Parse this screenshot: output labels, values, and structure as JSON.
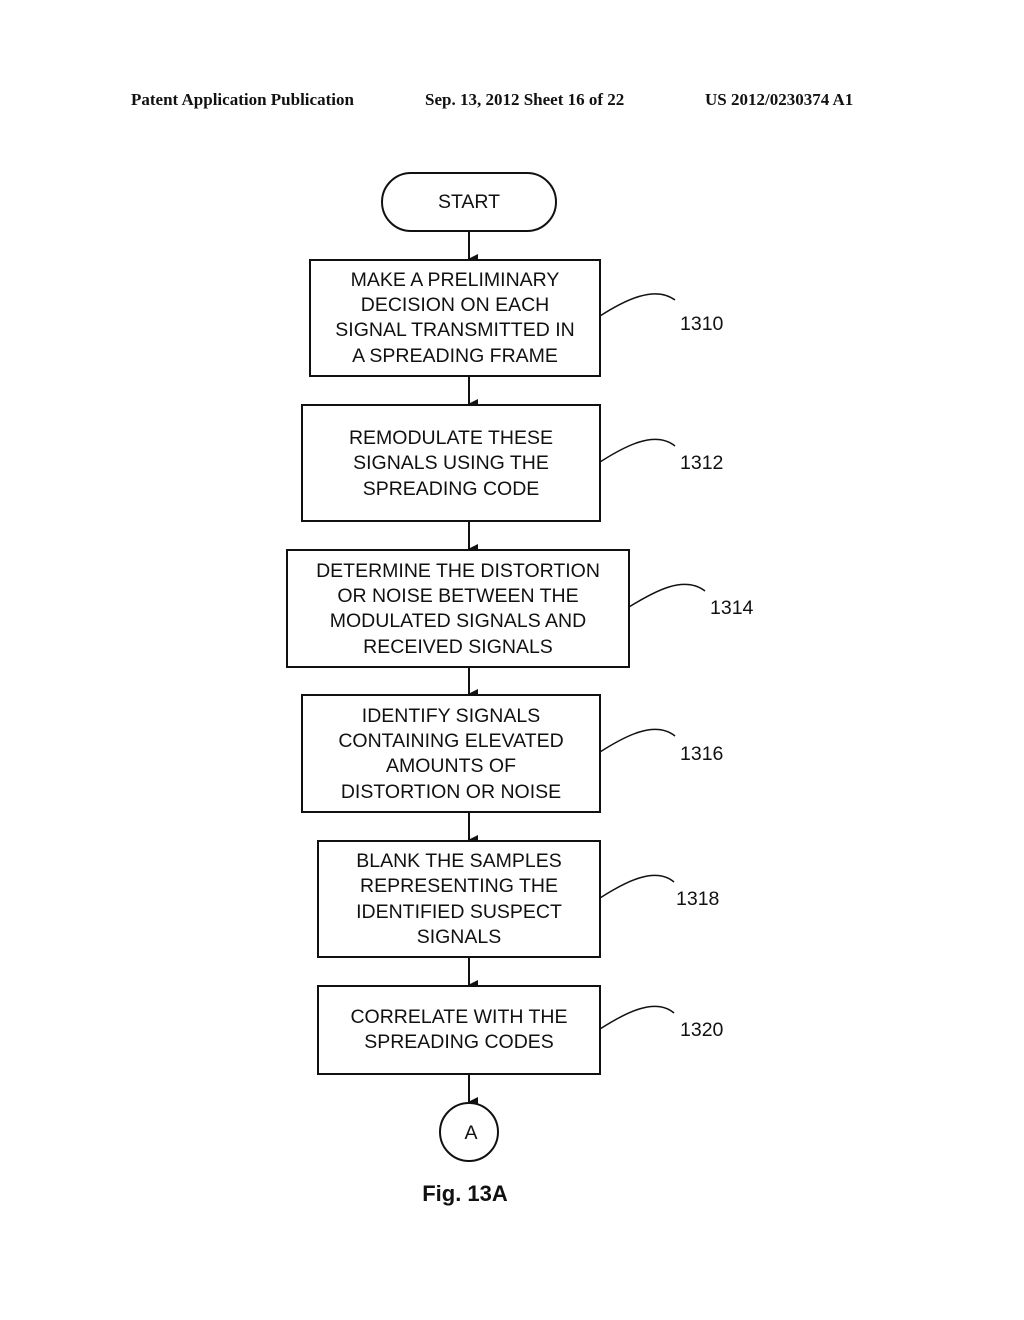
{
  "header": {
    "left": "Patent Application Publication",
    "date_sheet": "Sep. 13, 2012   Sheet 16 of 22",
    "number": "US 2012/0230374 A1"
  },
  "flowchart": {
    "start_label": "START",
    "steps": [
      {
        "ref": "1310",
        "lines": [
          "MAKE A PRELIMINARY",
          "DECISION ON EACH",
          "SIGNAL TRANSMITTED IN",
          "A SPREADING FRAME"
        ]
      },
      {
        "ref": "1312",
        "lines": [
          "REMODULATE THESE",
          "SIGNALS USING THE",
          "SPREADING CODE"
        ]
      },
      {
        "ref": "1314",
        "lines": [
          "DETERMINE THE DISTORTION",
          "OR NOISE BETWEEN THE",
          "MODULATED SIGNALS AND",
          "RECEIVED SIGNALS"
        ]
      },
      {
        "ref": "1316",
        "lines": [
          "IDENTIFY SIGNALS",
          "CONTAINING ELEVATED",
          "AMOUNTS OF",
          "DISTORTION OR NOISE"
        ]
      },
      {
        "ref": "1318",
        "lines": [
          "BLANK THE SAMPLES",
          "REPRESENTING THE",
          "IDENTIFIED SUSPECT",
          "SIGNALS"
        ]
      },
      {
        "ref": "1320",
        "lines": [
          "CORRELATE WITH THE",
          "SPREADING CODES"
        ]
      }
    ],
    "connector_label": "A",
    "figure_label": "Fig. 13A"
  }
}
